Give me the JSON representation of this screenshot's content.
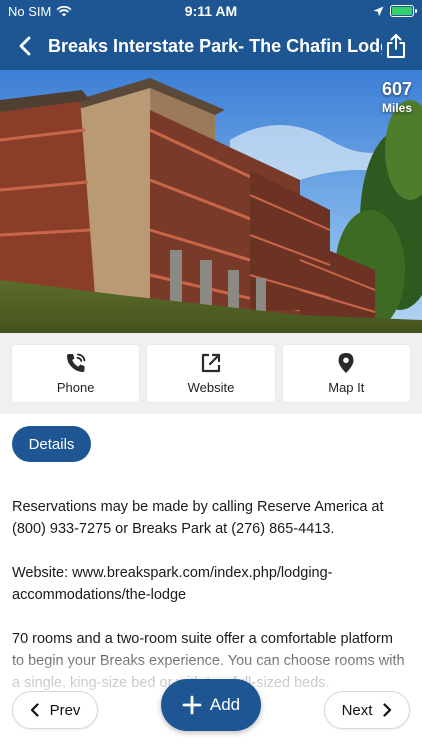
{
  "status_bar": {
    "carrier": "No SIM",
    "time": "9:11 AM",
    "icons": [
      "wifi-icon",
      "location-arrow-icon",
      "battery-charging-icon"
    ]
  },
  "nav": {
    "title": "Breaks Interstate Park- The Chafin Lodge",
    "back_icon": "chevron-left-icon",
    "share_icon": "share-icon"
  },
  "hero": {
    "distance_value": "607",
    "distance_unit": "Miles"
  },
  "actions": [
    {
      "label": "Phone",
      "icon": "phone-icon"
    },
    {
      "label": "Website",
      "icon": "external-link-icon"
    },
    {
      "label": "Map It",
      "icon": "map-pin-icon"
    }
  ],
  "details_button": "Details",
  "description": [
    "Reservations may be made by calling Reserve America at (800) 933-7275 or Breaks Park at (276) 865-4413.",
    "Website: www.breakspark.com/index.php/lodging-accommodations/the-lodge",
    "70 rooms and a two-room suite offer a comfortable platform to begin your Breaks experience. You can choose rooms with a single, king-size bed or with two full-sized beds."
  ],
  "bottom": {
    "prev": "Prev",
    "add": "Add",
    "next": "Next"
  },
  "colors": {
    "brand_blue": "#1d5693",
    "battery_green": "#33d16b"
  }
}
